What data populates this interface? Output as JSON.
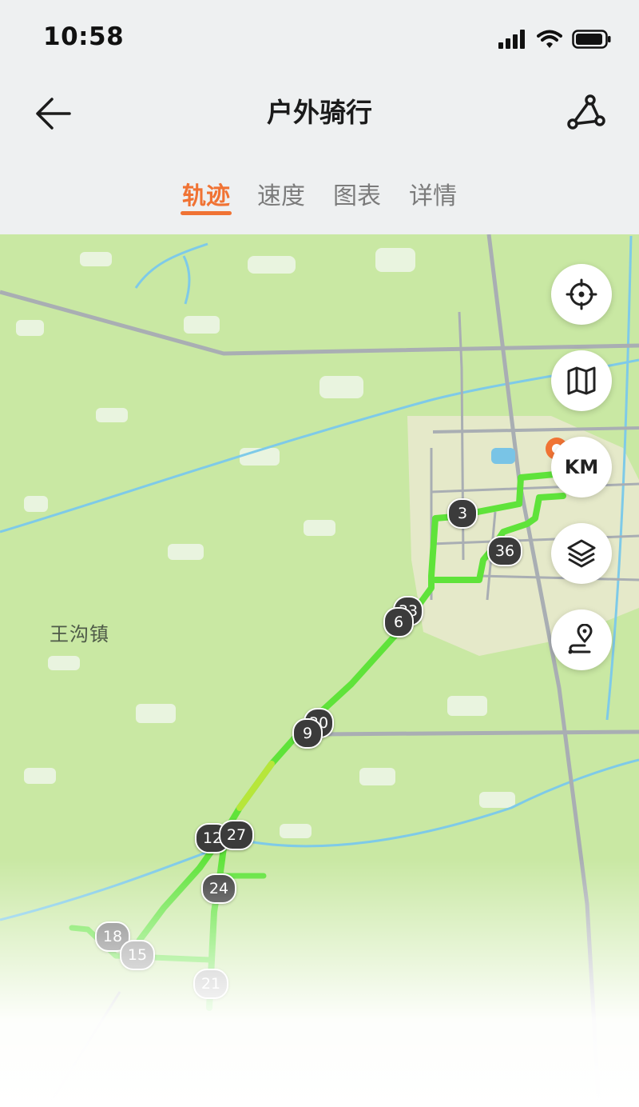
{
  "status_bar": {
    "time": "10:58"
  },
  "header": {
    "title": "户外骑行"
  },
  "tabs": [
    {
      "label": "轨迹",
      "active": true
    },
    {
      "label": "速度",
      "active": false
    },
    {
      "label": "图表",
      "active": false
    },
    {
      "label": "详情",
      "active": false
    }
  ],
  "map": {
    "place_label": "王沟镇",
    "controls": {
      "unit_label": "KM"
    },
    "km_markers": [
      "3",
      "36",
      "33",
      "6",
      "30",
      "9",
      "12",
      "27",
      "24",
      "18",
      "15",
      "21"
    ],
    "colors": {
      "accent": "#f07334",
      "track": "#5fe33a",
      "marker_dark": "#3b3b3b",
      "marker_light": "#8c8c8c"
    }
  }
}
